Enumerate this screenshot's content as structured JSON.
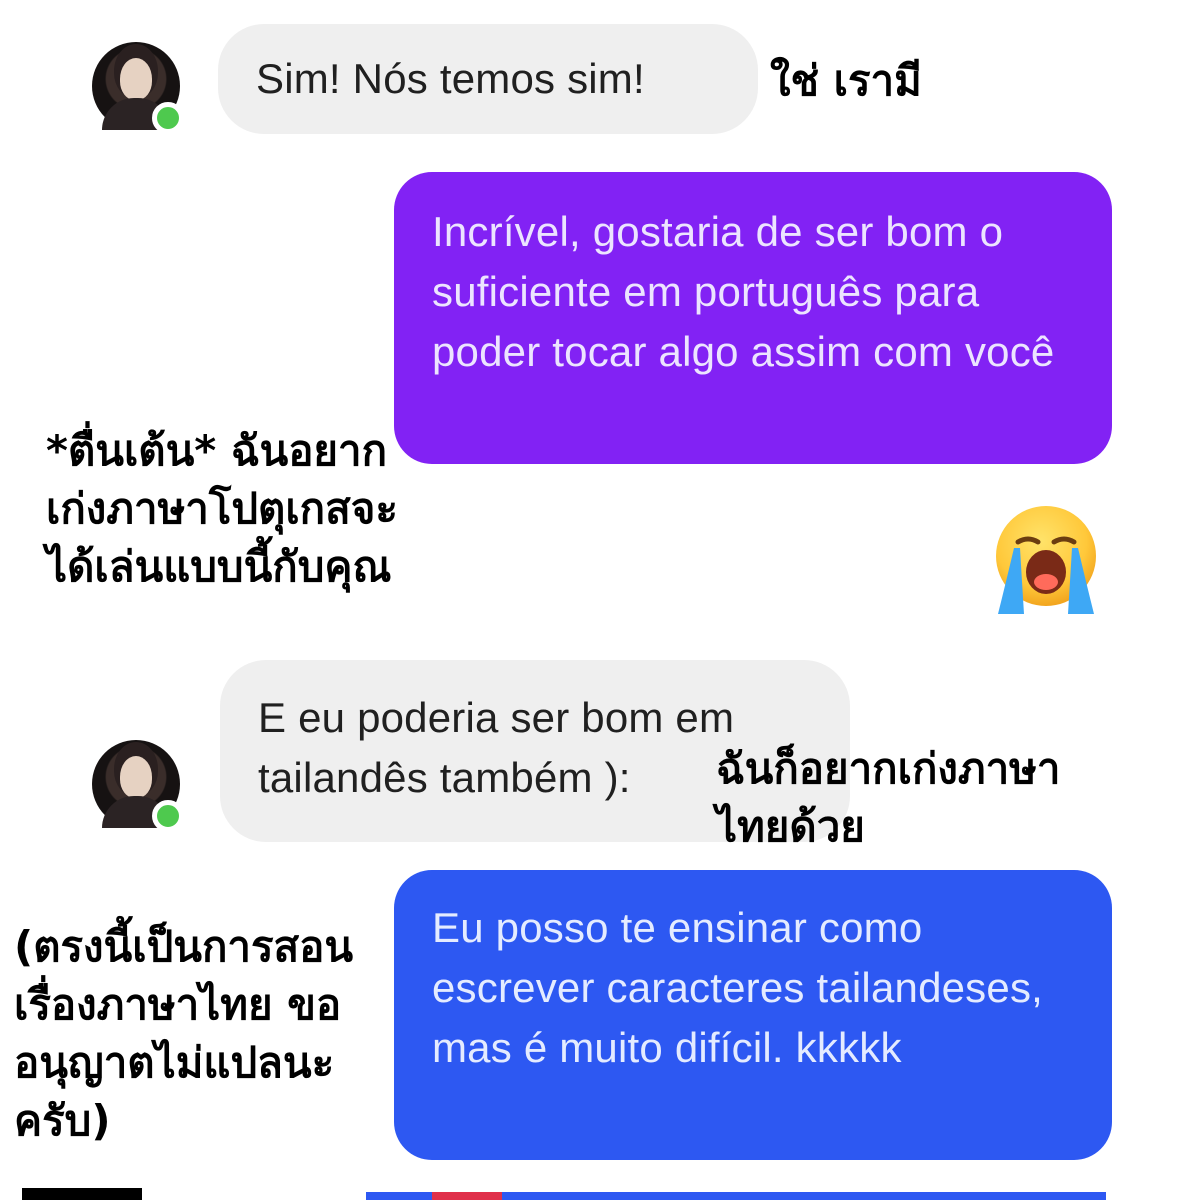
{
  "conversation": {
    "messages": [
      {
        "sender": "contact",
        "text": "Sim! Nós temos sim!"
      },
      {
        "sender": "me",
        "text": "Incrível, gostaria de ser bom o suficiente em português para poder tocar algo assim com você"
      },
      {
        "sender": "me",
        "emoji": "loudly-crying-face"
      },
      {
        "sender": "contact",
        "text": "E eu poderia ser bom em tailandês também ):"
      },
      {
        "sender": "me",
        "text": "Eu posso te ensinar como escrever caracteres tailandeses, mas é muito difícil. kkkkk"
      }
    ]
  },
  "translations": {
    "t1": "ใช่ เรามี",
    "t2": "*ตื่นเต้น* ฉันอยาก\nเก่งภาษาโปตุเกสจะ\nได้เล่นแบบนี้กับคุณ",
    "t3": "ฉันก็อยากเก่งภาษา\nไทยด้วย",
    "t4": "(ตรงนี้เป็นการสอน\nเรื่องภาษาไทย ขอ\nอนุญาตไม่แปลนะ\nครับ)"
  },
  "colors": {
    "received_bubble": "#efefef",
    "sent_purple": "#8222f4",
    "sent_blue": "#2d58f2",
    "online_dot": "#4ec94e"
  },
  "icons": [
    "contact-avatar",
    "online-status-dot",
    "loudly-crying-face-emoji"
  ]
}
